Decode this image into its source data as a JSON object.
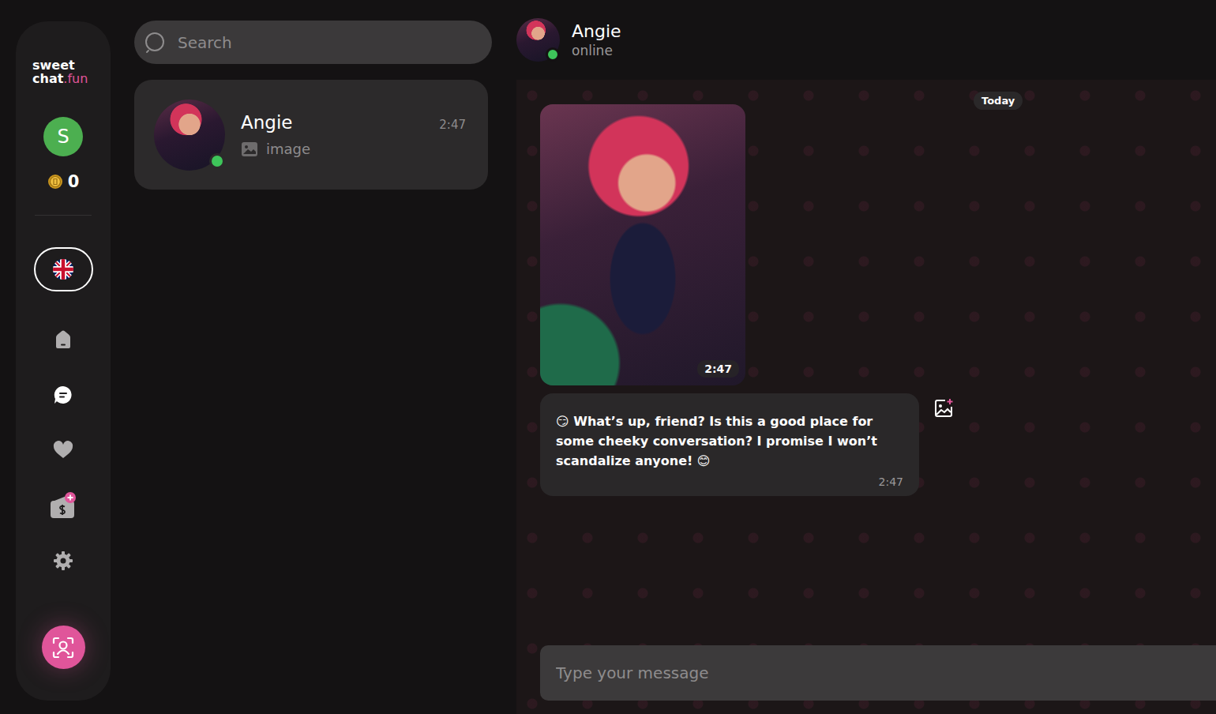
{
  "logo": {
    "top": "sweet",
    "main": "chat",
    "accent": ".fun"
  },
  "user": {
    "initial": "S",
    "coins": "0"
  },
  "nav": [
    {
      "kind": "home",
      "selected": false
    },
    {
      "kind": "chat",
      "selected": true
    },
    {
      "kind": "favorites",
      "selected": false
    },
    {
      "kind": "wallet",
      "selected": false
    },
    {
      "kind": "settings",
      "selected": false
    }
  ],
  "search": {
    "placeholder": "Search"
  },
  "contacts": [
    {
      "name": "Angie",
      "preview": "image",
      "time": "2:47",
      "online": true,
      "selected": true
    }
  ],
  "chat": {
    "name": "Angie",
    "status": "online",
    "online": true,
    "date": "Today",
    "messages": [
      {
        "kind": "image",
        "time": "2:47"
      },
      {
        "kind": "text",
        "text": "😏 What’s up, friend? Is this a good place for some cheeky conversation? I promise I won’t scandalize anyone! 😊",
        "time": "2:47"
      }
    ]
  },
  "composer": {
    "placeholder": "Type your message"
  }
}
